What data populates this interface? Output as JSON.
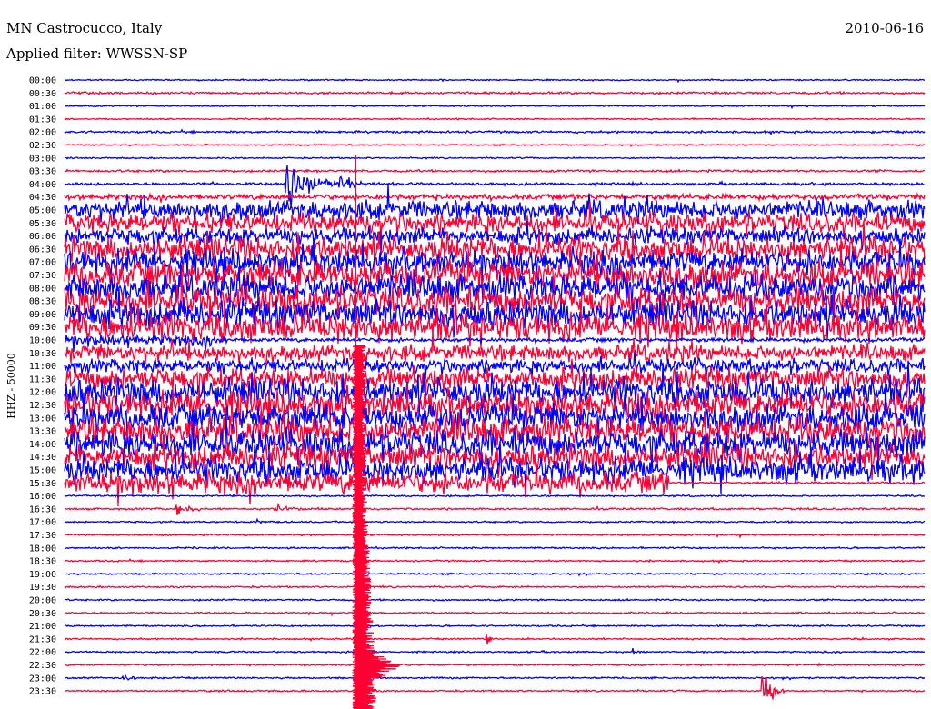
{
  "header": {
    "station": "MN Castrocucco, Italy",
    "filter": "Applied filter: WWSSN-SP",
    "date": "2010-06-16"
  },
  "chart_data": {
    "type": "line",
    "title": "MN Castrocucco, Italy",
    "ylabel": "HHZ - 50000",
    "minutes_per_row": 30,
    "colors": {
      "even": "#0000ff",
      "odd": "#ff0033"
    },
    "rows": [
      {
        "label": "00:00",
        "amp": 0.5
      },
      {
        "label": "00:30",
        "amp": 0.8
      },
      {
        "label": "01:00",
        "amp": 0.5
      },
      {
        "label": "01:30",
        "amp": 0.5
      },
      {
        "label": "02:00",
        "amp": 0.8
      },
      {
        "label": "02:30",
        "amp": 0.5
      },
      {
        "label": "03:00",
        "amp": 0.5
      },
      {
        "label": "03:30",
        "amp": 0.8
      },
      {
        "label": "04:00",
        "amp": 1
      },
      {
        "label": "04:30",
        "amp": 2
      },
      {
        "label": "05:00",
        "amp": 7
      },
      {
        "label": "05:30",
        "amp": 7
      },
      {
        "label": "06:00",
        "amp": 6
      },
      {
        "label": "06:30",
        "amp": 9
      },
      {
        "label": "07:00",
        "amp": 9
      },
      {
        "label": "07:30",
        "amp": 10
      },
      {
        "label": "08:00",
        "amp": 10
      },
      {
        "label": "08:30",
        "amp": 10
      },
      {
        "label": "09:00",
        "amp": 10
      },
      {
        "label": "09:30",
        "amp": 10
      },
      {
        "label": "10:00",
        "amp": 4
      },
      {
        "label": "10:30",
        "amp": 6
      },
      {
        "label": "11:00",
        "amp": 5
      },
      {
        "label": "11:30",
        "amp": 8
      },
      {
        "label": "12:00",
        "amp": 10
      },
      {
        "label": "12:30",
        "amp": 10
      },
      {
        "label": "13:00",
        "amp": 10
      },
      {
        "label": "13:30",
        "amp": 10
      },
      {
        "label": "14:00",
        "amp": 10
      },
      {
        "label": "14:30",
        "amp": 9
      },
      {
        "label": "15:00",
        "amp": 9
      },
      {
        "label": "15:30",
        "amp": 8
      },
      {
        "label": "16:00",
        "amp": 0.6
      },
      {
        "label": "16:30",
        "amp": 0.7
      },
      {
        "label": "17:00",
        "amp": 0.6
      },
      {
        "label": "17:30",
        "amp": 0.6
      },
      {
        "label": "18:00",
        "amp": 0.6
      },
      {
        "label": "18:30",
        "amp": 0.6
      },
      {
        "label": "19:00",
        "amp": 0.6
      },
      {
        "label": "19:30",
        "amp": 0.6
      },
      {
        "label": "20:00",
        "amp": 0.6
      },
      {
        "label": "20:30",
        "amp": 0.6
      },
      {
        "label": "21:00",
        "amp": 0.6
      },
      {
        "label": "21:30",
        "amp": 0.6
      },
      {
        "label": "22:00",
        "amp": 0.6
      },
      {
        "label": "22:30",
        "amp": 0.6
      },
      {
        "label": "23:00",
        "amp": 0.6
      },
      {
        "label": "23:30",
        "amp": 0.6
      }
    ],
    "events": [
      {
        "row": "04:00",
        "minute": 7.7,
        "amp": 20,
        "dur": 2.5
      },
      {
        "row": "04:00",
        "minute": 9.6,
        "amp": 10,
        "dur": 1.5
      },
      {
        "row": "16:30",
        "minute": 3.9,
        "amp": 4,
        "dur": 1.9
      },
      {
        "row": "16:30",
        "minute": 7.3,
        "amp": 4,
        "dur": 1.9
      },
      {
        "row": "17:00",
        "minute": 6.7,
        "amp": 3,
        "dur": 0.8
      },
      {
        "row": "21:30",
        "minute": 14.7,
        "amp": 6,
        "dur": 0.4
      },
      {
        "row": "22:00",
        "minute": 19.8,
        "amp": 2,
        "dur": 0.4
      },
      {
        "row": "23:00",
        "minute": 2,
        "amp": 4,
        "dur": 1.3
      },
      {
        "row": "23:30",
        "minute": 24.3,
        "amp": 30,
        "dur": 0.8
      }
    ],
    "mainshock": {
      "row": "16:00",
      "minute": 10.1
    }
  }
}
